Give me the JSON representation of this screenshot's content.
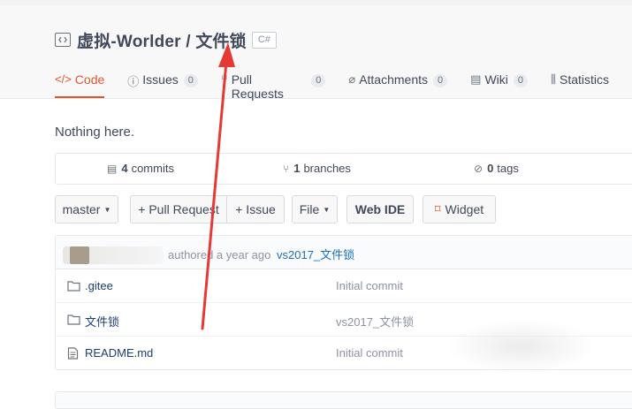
{
  "repo": {
    "name": "虚拟-Worlder / 文件锁",
    "language_badge": "C#"
  },
  "tabs": [
    {
      "label": "Code",
      "icon": "code-icon",
      "active": true
    },
    {
      "label": "Issues",
      "icon": "issues-icon",
      "count": "0"
    },
    {
      "label": "Pull Requests",
      "icon": "pull-request-icon",
      "count": "0"
    },
    {
      "label": "Attachments",
      "icon": "paperclip-icon",
      "count": "0"
    },
    {
      "label": "Wiki",
      "icon": "book-icon",
      "count": "0"
    },
    {
      "label": "Statistics",
      "icon": "bar-chart-icon"
    }
  ],
  "empty_message": "Nothing here.",
  "stats": {
    "commits_count": "4",
    "commits_label": "commits",
    "branches_count": "1",
    "branches_label": "branches",
    "tags_count": "0",
    "tags_label": "tags"
  },
  "toolbar": {
    "branch": "master",
    "pull_request": "+ Pull Request",
    "issue": "+ Issue",
    "file": "File",
    "web_ide": "Web IDE",
    "widget": "Widget"
  },
  "last_commit": {
    "time": "authored a year ago",
    "message": "vs2017_文件锁"
  },
  "files": [
    {
      "name": ".gitee",
      "type": "folder",
      "commit": "Initial commit"
    },
    {
      "name": "文件锁",
      "type": "folder",
      "commit": "vs2017_文件锁"
    },
    {
      "name": "README.md",
      "type": "file",
      "commit": "Initial commit"
    }
  ],
  "colors": {
    "accent": "#e2532d",
    "link": "#1d6fb8",
    "annotation_arrow": "#e53935"
  }
}
